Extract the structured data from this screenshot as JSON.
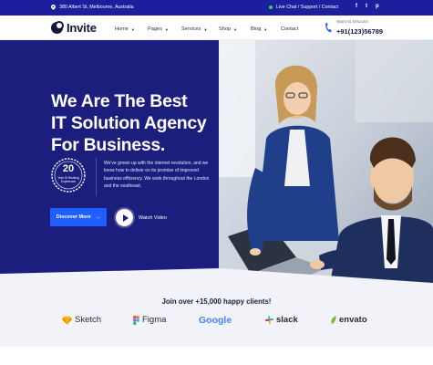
{
  "topbar": {
    "address": "380 Albert St, Melbourne, Australia",
    "live_chat": "Live Chat / Support / Contact",
    "social": [
      "f",
      "t",
      "p"
    ]
  },
  "header": {
    "logo": "Invite",
    "nav": [
      "Home",
      "Pages",
      "Services",
      "Shop",
      "Blog",
      "Contact"
    ],
    "discuss_label": "Want to Discuss:",
    "phone": "+91(123)56789"
  },
  "hero": {
    "headline_line1": "We Are The Best",
    "headline_line2": "IT Solution Agency",
    "headline_line3": "For Business.",
    "badge_number": "20",
    "badge_caption": "Year Of Working Experience",
    "description": "We've grown up with the internet revolution, and we know how to deliver on its promise of improved business efficiency. We work throughout the London and the southeast.",
    "cta_label": "Discover More",
    "video_label": "Watch Video"
  },
  "clients": {
    "heading": "Join over +15,000 happy clients!",
    "brands": [
      "Sketch",
      "Figma",
      "Google",
      "slack",
      "envato"
    ]
  },
  "colors": {
    "topbar": "#1b1f9e",
    "hero_bg": "#1b1e7c",
    "cta": "#1f5fff",
    "accent_green": "#39d353"
  }
}
